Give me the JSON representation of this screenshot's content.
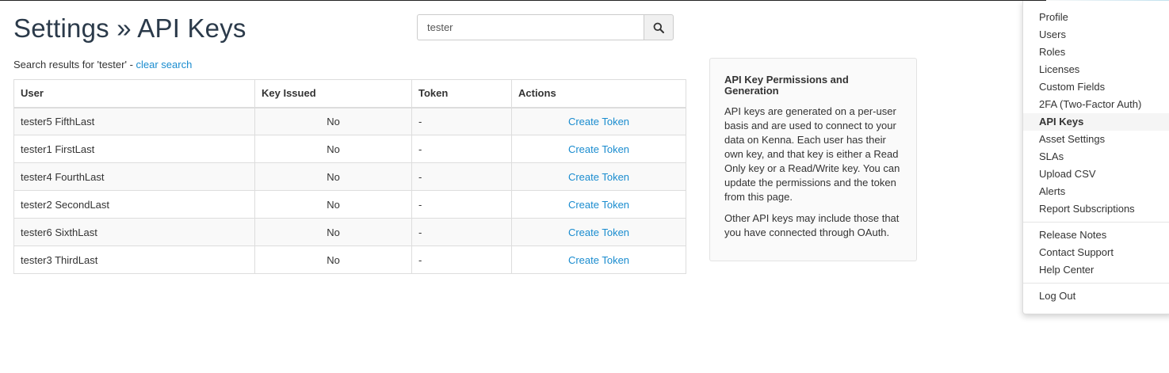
{
  "header": {
    "title": "Settings » API Keys"
  },
  "search": {
    "value": "tester",
    "placeholder": "",
    "button_icon": "search-icon"
  },
  "results": {
    "prefix": "Search results for 'tester' - ",
    "clear_label": "clear search"
  },
  "table": {
    "headers": {
      "user": "User",
      "key_issued": "Key Issued",
      "token": "Token",
      "actions": "Actions"
    },
    "rows": [
      {
        "user": "tester5 FifthLast",
        "key_issued": "No",
        "token": "-",
        "action": "Create Token"
      },
      {
        "user": "tester1 FirstLast",
        "key_issued": "No",
        "token": "-",
        "action": "Create Token"
      },
      {
        "user": "tester4 FourthLast",
        "key_issued": "No",
        "token": "-",
        "action": "Create Token"
      },
      {
        "user": "tester2 SecondLast",
        "key_issued": "No",
        "token": "-",
        "action": "Create Token"
      },
      {
        "user": "tester6 SixthLast",
        "key_issued": "No",
        "token": "-",
        "action": "Create Token"
      },
      {
        "user": "tester3 ThirdLast",
        "key_issued": "No",
        "token": "-",
        "action": "Create Token"
      }
    ]
  },
  "info_panel": {
    "title": "API Key Permissions and Generation",
    "paragraph1": "API keys are generated on a per-user basis and are used to connect to your data on Kenna. Each user has their own key, and that key is either a Read Only key or a Read/Write key. You can update the permissions and the token from this page.",
    "paragraph2": "Other API keys may include those that you have connected through OAuth."
  },
  "menu": {
    "items": [
      "Profile",
      "Users",
      "Roles",
      "Licenses",
      "Custom Fields",
      "2FA (Two-Factor Auth)",
      "API Keys",
      "Asset Settings",
      "SLAs",
      "Upload CSV",
      "Alerts",
      "Report Subscriptions"
    ],
    "active": "API Keys",
    "secondary": [
      "Release Notes",
      "Contact Support",
      "Help Center"
    ],
    "logout": "Log Out"
  },
  "colors": {
    "link": "#1a8ccf",
    "title": "#2b3a4a",
    "row_stripe": "#f9f9f9"
  }
}
